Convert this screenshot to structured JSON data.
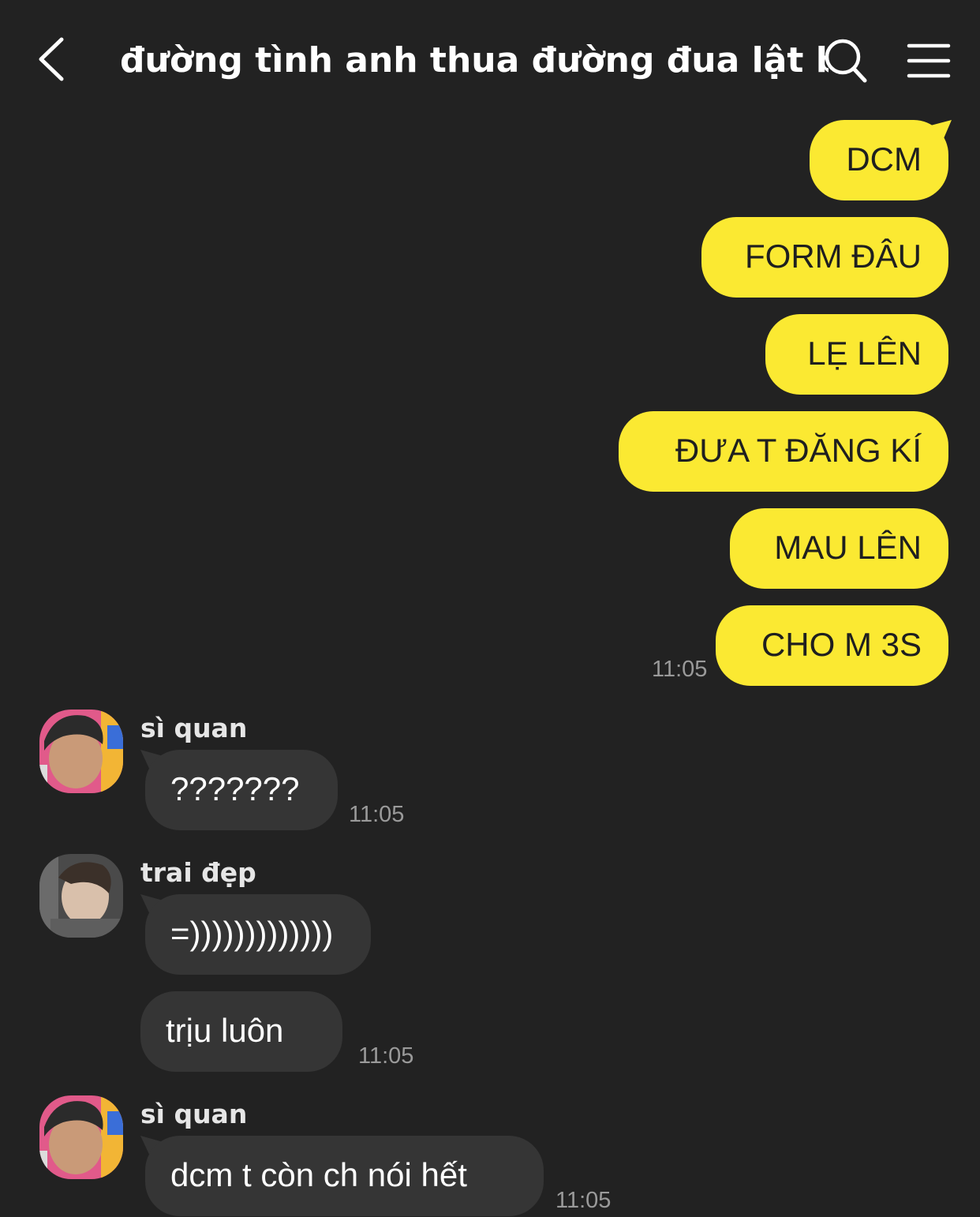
{
  "header": {
    "title": "đường tình anh thua đường đua lật bánh",
    "back_icon": "chevron-left-icon",
    "search_icon": "search-icon",
    "menu_icon": "hamburger-menu-icon"
  },
  "colors": {
    "background": "#222222",
    "outgoing_bubble": "#fbe932",
    "incoming_bubble": "#353535",
    "timestamp": "#9a9a9a"
  },
  "outgoing": {
    "messages": [
      "DCM",
      "FORM ĐÂU",
      "LẸ LÊN",
      "ĐƯA T ĐĂNG KÍ",
      "MAU LÊN",
      "CHO M 3S"
    ],
    "time": "11:05"
  },
  "groups": [
    {
      "sender": "sì quan",
      "messages": [
        "???????"
      ],
      "time": "11:05"
    },
    {
      "sender": "trai đẹp",
      "messages": [
        "=)))))))))))))",
        "trịu luôn"
      ],
      "time": "11:05"
    },
    {
      "sender": "sì quan",
      "messages": [
        "dcm t còn ch nói hết"
      ],
      "time": "11:05"
    }
  ]
}
